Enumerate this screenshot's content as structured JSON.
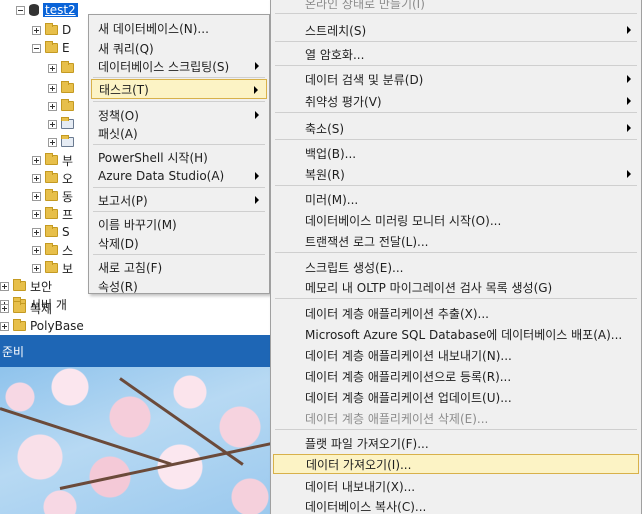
{
  "tree": {
    "db_label": "test2",
    "rows": [
      {
        "label": "D",
        "expander": "plus"
      },
      {
        "label": "E",
        "expander": "minus"
      },
      {
        "label": "",
        "expander": "plus"
      },
      {
        "label": "",
        "expander": "plus"
      },
      {
        "label": "",
        "expander": "plus"
      },
      {
        "label": "",
        "expander": "plus"
      },
      {
        "label": "",
        "expander": "plus"
      },
      {
        "label": "부",
        "expander": "plus"
      },
      {
        "label": "오",
        "expander": "plus"
      },
      {
        "label": "동",
        "expander": "plus"
      },
      {
        "label": "프",
        "expander": "plus"
      },
      {
        "label": "S",
        "expander": "plus"
      },
      {
        "label": "스",
        "expander": "plus"
      },
      {
        "label": "보",
        "expander": "plus"
      }
    ],
    "root_rows": [
      {
        "label": "보안"
      },
      {
        "label": "서버 개"
      },
      {
        "label": "복제"
      },
      {
        "label": "PolyBase"
      }
    ]
  },
  "bottom_pane": {
    "header": "준비"
  },
  "context_menu": {
    "items": [
      {
        "label": "새 데이터베이스(N)...",
        "submenu": false
      },
      {
        "label": "새 쿼리(Q)",
        "submenu": false
      },
      {
        "label": "데이터베이스 스크립팅(S)",
        "submenu": true
      },
      {
        "label": "태스크(T)",
        "submenu": true,
        "highlighted": true
      },
      {
        "label": "정책(O)",
        "submenu": true
      },
      {
        "label": "패싯(A)",
        "submenu": false
      },
      {
        "label": "PowerShell 시작(H)",
        "submenu": false
      },
      {
        "label": "Azure Data Studio(A)",
        "submenu": true
      },
      {
        "label": "보고서(P)",
        "submenu": true
      },
      {
        "label": "이름 바꾸기(M)",
        "submenu": false
      },
      {
        "label": "삭제(D)",
        "submenu": false
      },
      {
        "label": "새로 고침(F)",
        "submenu": false
      },
      {
        "label": "속성(R)",
        "submenu": false
      }
    ]
  },
  "tasks_menu": {
    "items": [
      {
        "label": "온라인 상태로 만들기(I)",
        "submenu": false,
        "disabled": true
      },
      {
        "label": "스트레치(S)",
        "submenu": true
      },
      {
        "label": "열 암호화...",
        "submenu": false
      },
      {
        "label": "데이터 검색 및 분류(D)",
        "submenu": true
      },
      {
        "label": "취약성 평가(V)",
        "submenu": true
      },
      {
        "label": "축소(S)",
        "submenu": true
      },
      {
        "label": "백업(B)...",
        "submenu": false
      },
      {
        "label": "복원(R)",
        "submenu": true
      },
      {
        "label": "미러(M)...",
        "submenu": false
      },
      {
        "label": "데이터베이스 미러링 모니터 시작(O)...",
        "submenu": false
      },
      {
        "label": "트랜잭션 로그 전달(L)...",
        "submenu": false
      },
      {
        "label": "스크립트 생성(E)...",
        "submenu": false
      },
      {
        "label": "메모리 내 OLTP 마이그레이션 검사 목록 생성(G)",
        "submenu": false
      },
      {
        "label": "데이터 계층 애플리케이션 추출(X)...",
        "submenu": false
      },
      {
        "label": "Microsoft Azure SQL Database에 데이터베이스 배포(A)...",
        "submenu": false
      },
      {
        "label": "데이터 계층 애플리케이션 내보내기(N)...",
        "submenu": false
      },
      {
        "label": "데이터 계층 애플리케이션으로 등록(R)...",
        "submenu": false
      },
      {
        "label": "데이터 계층 애플리케이션 업데이트(U)...",
        "submenu": false
      },
      {
        "label": "데이터 계층 애플리케이션 삭제(E)...",
        "submenu": false,
        "disabled": true
      },
      {
        "label": "플랫 파일 가져오기(F)...",
        "submenu": false
      },
      {
        "label": "데이터 가져오기(I)...",
        "submenu": false,
        "highlighted": true
      },
      {
        "label": "데이터 내보내기(X)...",
        "submenu": false
      },
      {
        "label": "데이터베이스 복사(C)...",
        "submenu": false
      }
    ]
  },
  "colors": {
    "selection": "#0a64d8",
    "pane_header": "#1e66b5",
    "menu_bg": "#f0f0f0",
    "highlight_bg": "#fcf3c5",
    "highlight_border": "#d8b14a"
  }
}
